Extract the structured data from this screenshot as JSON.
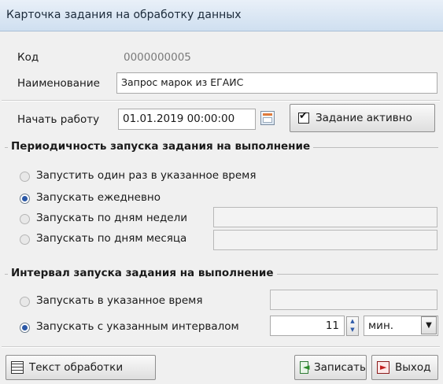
{
  "window": {
    "title": "Карточка задания на обработку данных"
  },
  "fields": {
    "code_label": "Код",
    "code_value": "0000000005",
    "name_label": "Наименование",
    "name_value": "Запрос марок из ЕГАИС",
    "start_label": "Начать работу",
    "start_value": "01.01.2019 00:00:00",
    "active_label": "Задание активно"
  },
  "periodicity": {
    "title": "Периодичность запуска задания на выполнение",
    "options": [
      {
        "label": "Запустить один раз в указанное время",
        "checked": false
      },
      {
        "label": "Запускать ежедневно",
        "checked": true
      },
      {
        "label": "Запускать по дням недели",
        "checked": false
      },
      {
        "label": "Запускать по дням месяца",
        "checked": false
      }
    ]
  },
  "interval": {
    "title": "Интервал запуска задания на выполнение",
    "options": [
      {
        "label": "Запускать в указанное время",
        "checked": false
      },
      {
        "label": "Запускать с указанным интервалом",
        "checked": true
      }
    ],
    "value": "11",
    "unit": "мин."
  },
  "footer": {
    "processing_text_label": "Текст обработки",
    "save_label": "Записать",
    "exit_label": "Выход"
  },
  "colors": {
    "title_bg": "#dde8f4",
    "radio_checked": "#2b58a7"
  }
}
